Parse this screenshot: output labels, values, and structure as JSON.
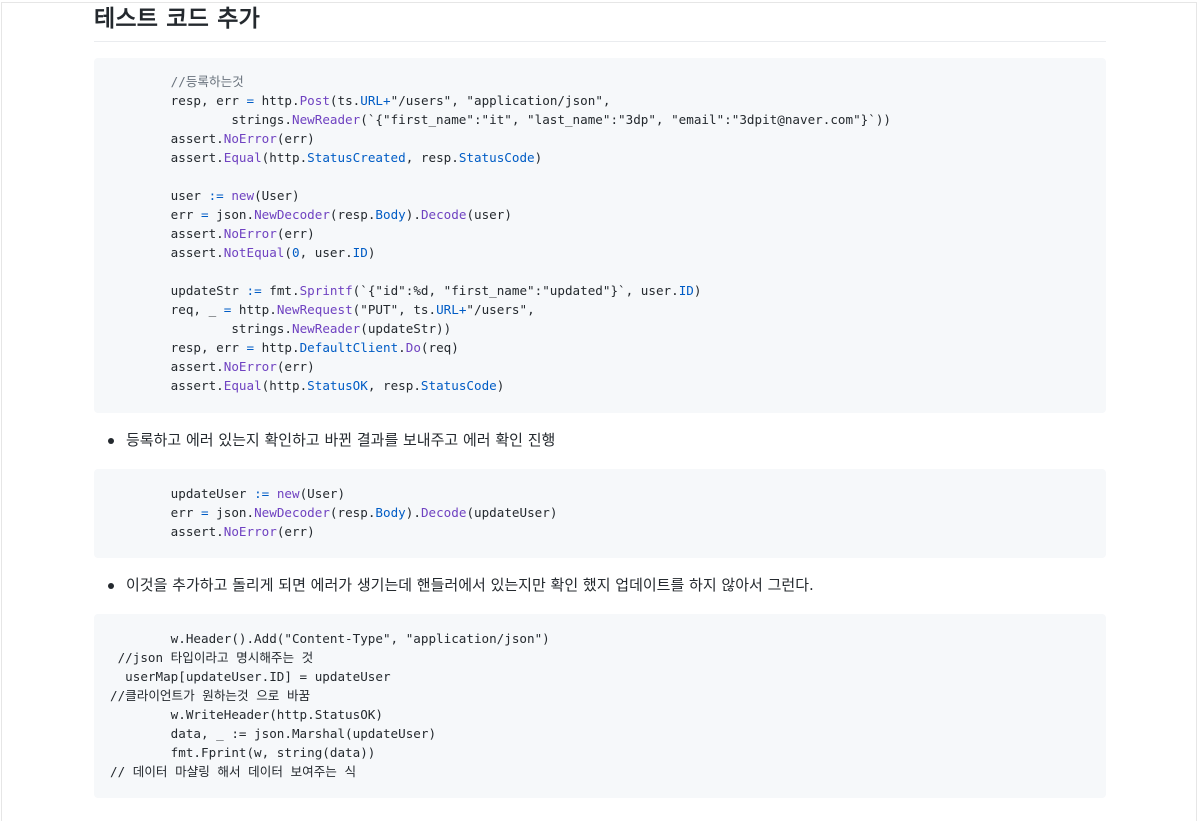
{
  "heading": "테스트 코드 추가",
  "code_block_1": {
    "lines": [
      [
        {
          "t": "        "
        },
        {
          "t": "//등록하는것",
          "c": "c-com"
        }
      ],
      [
        {
          "t": "        resp, err "
        },
        {
          "t": "=",
          "c": "c-op"
        },
        {
          "t": " http."
        },
        {
          "t": "Post",
          "c": "c-fn"
        },
        {
          "t": "(ts."
        },
        {
          "t": "URL",
          "c": "c-id"
        },
        {
          "t": "+",
          "c": "c-op"
        },
        {
          "t": "\"/users\", \"application/json\","
        }
      ],
      [
        {
          "t": "                strings."
        },
        {
          "t": "NewReader",
          "c": "c-fn"
        },
        {
          "t": "(`{\"first_name\":\"it\", \"last_name\":\"3dp\", \"email\":\"3dpit@naver.com\"}`))"
        }
      ],
      [
        {
          "t": "        assert."
        },
        {
          "t": "NoError",
          "c": "c-fn"
        },
        {
          "t": "(err)"
        }
      ],
      [
        {
          "t": "        assert."
        },
        {
          "t": "Equal",
          "c": "c-fn"
        },
        {
          "t": "(http."
        },
        {
          "t": "StatusCreated",
          "c": "c-id"
        },
        {
          "t": ", resp."
        },
        {
          "t": "StatusCode",
          "c": "c-id"
        },
        {
          "t": ")"
        }
      ],
      [
        {
          "t": ""
        }
      ],
      [
        {
          "t": "        user "
        },
        {
          "t": ":=",
          "c": "c-op"
        },
        {
          "t": " "
        },
        {
          "t": "new",
          "c": "c-fn"
        },
        {
          "t": "(User)"
        }
      ],
      [
        {
          "t": "        err "
        },
        {
          "t": "=",
          "c": "c-op"
        },
        {
          "t": " json."
        },
        {
          "t": "NewDecoder",
          "c": "c-fn"
        },
        {
          "t": "(resp."
        },
        {
          "t": "Body",
          "c": "c-id"
        },
        {
          "t": ")."
        },
        {
          "t": "Decode",
          "c": "c-fn"
        },
        {
          "t": "(user)"
        }
      ],
      [
        {
          "t": "        assert."
        },
        {
          "t": "NoError",
          "c": "c-fn"
        },
        {
          "t": "(err)"
        }
      ],
      [
        {
          "t": "        assert."
        },
        {
          "t": "NotEqual",
          "c": "c-fn"
        },
        {
          "t": "("
        },
        {
          "t": "0",
          "c": "c-id"
        },
        {
          "t": ", user."
        },
        {
          "t": "ID",
          "c": "c-id"
        },
        {
          "t": ")"
        }
      ],
      [
        {
          "t": ""
        }
      ],
      [
        {
          "t": "        updateStr "
        },
        {
          "t": ":=",
          "c": "c-op"
        },
        {
          "t": " fmt."
        },
        {
          "t": "Sprintf",
          "c": "c-fn"
        },
        {
          "t": "(`{\"id\":%d, \"first_name\":\"updated\"}`, user."
        },
        {
          "t": "ID",
          "c": "c-id"
        },
        {
          "t": ")"
        }
      ],
      [
        {
          "t": "        req, _ "
        },
        {
          "t": "=",
          "c": "c-op"
        },
        {
          "t": " http."
        },
        {
          "t": "NewRequest",
          "c": "c-fn"
        },
        {
          "t": "(\"PUT\", ts."
        },
        {
          "t": "URL",
          "c": "c-id"
        },
        {
          "t": "+",
          "c": "c-op"
        },
        {
          "t": "\"/users\","
        }
      ],
      [
        {
          "t": "                strings."
        },
        {
          "t": "NewReader",
          "c": "c-fn"
        },
        {
          "t": "(updateStr))"
        }
      ],
      [
        {
          "t": "        resp, err "
        },
        {
          "t": "=",
          "c": "c-op"
        },
        {
          "t": " http."
        },
        {
          "t": "DefaultClient",
          "c": "c-id"
        },
        {
          "t": "."
        },
        {
          "t": "Do",
          "c": "c-fn"
        },
        {
          "t": "(req)"
        }
      ],
      [
        {
          "t": "        assert."
        },
        {
          "t": "NoError",
          "c": "c-fn"
        },
        {
          "t": "(err)"
        }
      ],
      [
        {
          "t": "        assert."
        },
        {
          "t": "Equal",
          "c": "c-fn"
        },
        {
          "t": "(http."
        },
        {
          "t": "StatusOK",
          "c": "c-id"
        },
        {
          "t": ", resp."
        },
        {
          "t": "StatusCode",
          "c": "c-id"
        },
        {
          "t": ")"
        }
      ]
    ]
  },
  "bullet_1": "등록하고 에러 있는지 확인하고 바뀐 결과를 보내주고 에러 확인 진행",
  "code_block_2": {
    "lines": [
      [
        {
          "t": "        updateUser "
        },
        {
          "t": ":=",
          "c": "c-op"
        },
        {
          "t": " "
        },
        {
          "t": "new",
          "c": "c-fn"
        },
        {
          "t": "(User)"
        }
      ],
      [
        {
          "t": "        err "
        },
        {
          "t": "=",
          "c": "c-op"
        },
        {
          "t": " json."
        },
        {
          "t": "NewDecoder",
          "c": "c-fn"
        },
        {
          "t": "(resp."
        },
        {
          "t": "Body",
          "c": "c-id"
        },
        {
          "t": ")."
        },
        {
          "t": "Decode",
          "c": "c-fn"
        },
        {
          "t": "(updateUser)"
        }
      ],
      [
        {
          "t": "        assert."
        },
        {
          "t": "NoError",
          "c": "c-fn"
        },
        {
          "t": "(err)"
        }
      ]
    ]
  },
  "bullet_2": "이것을 추가하고 돌리게 되면 에러가 생기는데 핸들러에서 있는지만 확인 했지 업데이트를 하지 않아서 그런다.",
  "code_block_3": {
    "lines": [
      [
        {
          "t": "        w.Header().Add(\"Content-Type\", \"application/json\")"
        }
      ],
      [
        {
          "t": " //json 타입이라고 명시해주는 것"
        }
      ],
      [
        {
          "t": "  userMap[updateUser.ID] = updateUser"
        }
      ],
      [
        {
          "t": "//클라이언트가 원하는것 으로 바꿈"
        }
      ],
      [
        {
          "t": "        w.WriteHeader(http.StatusOK)"
        }
      ],
      [
        {
          "t": "        data, _ := json.Marshal(updateUser)"
        }
      ],
      [
        {
          "t": "        fmt.Fprint(w, string(data))"
        }
      ],
      [
        {
          "t": "// 데이터 마샬링 해서 데이터 보여주는 식"
        }
      ]
    ]
  }
}
